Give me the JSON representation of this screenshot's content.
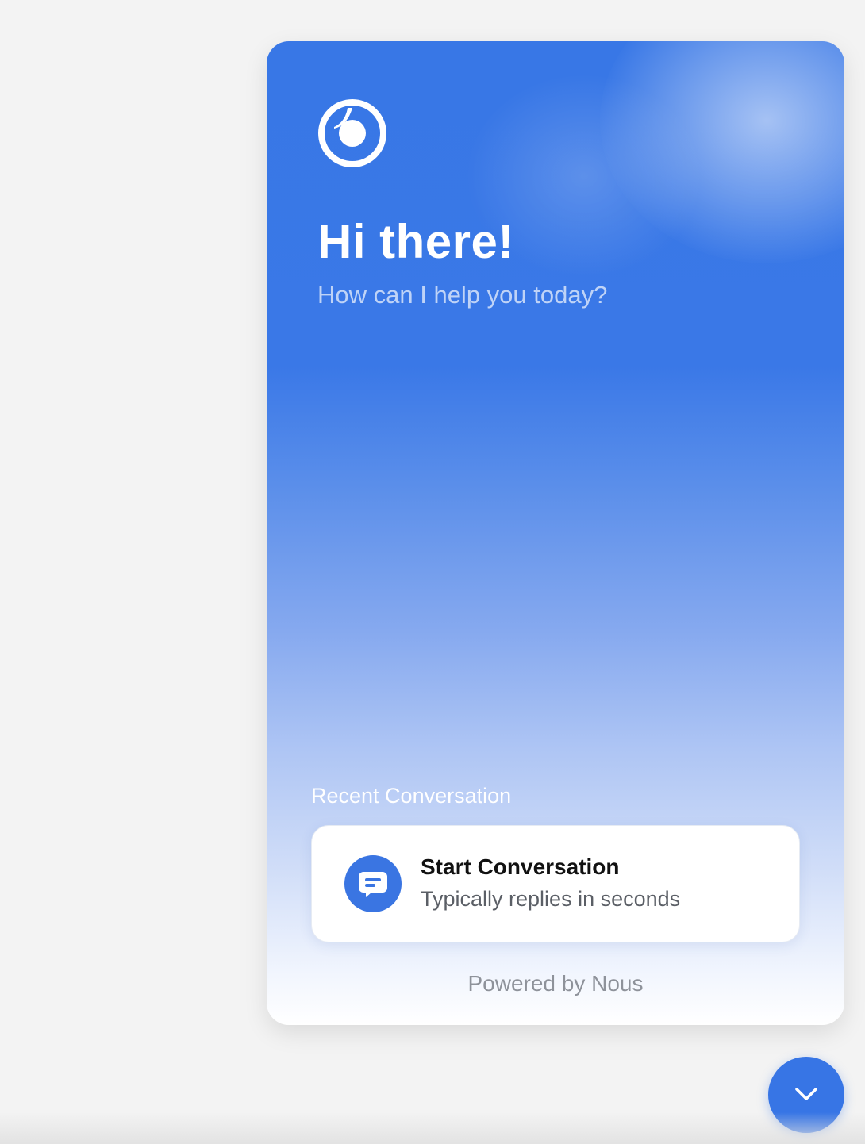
{
  "brand": {
    "accent_color": "#3877e6",
    "logo_icon": "eye-logo-icon"
  },
  "header": {
    "greeting": "Hi there!",
    "subtitle": "How can I help you today?"
  },
  "recent": {
    "section_label": "Recent Conversation",
    "card": {
      "icon": "chat-bubble-icon",
      "title": "Start Conversation",
      "subtitle": "Typically replies in seconds"
    }
  },
  "footer": {
    "powered_by": "Powered by Nous"
  },
  "launcher": {
    "icon": "chevron-down-icon"
  }
}
